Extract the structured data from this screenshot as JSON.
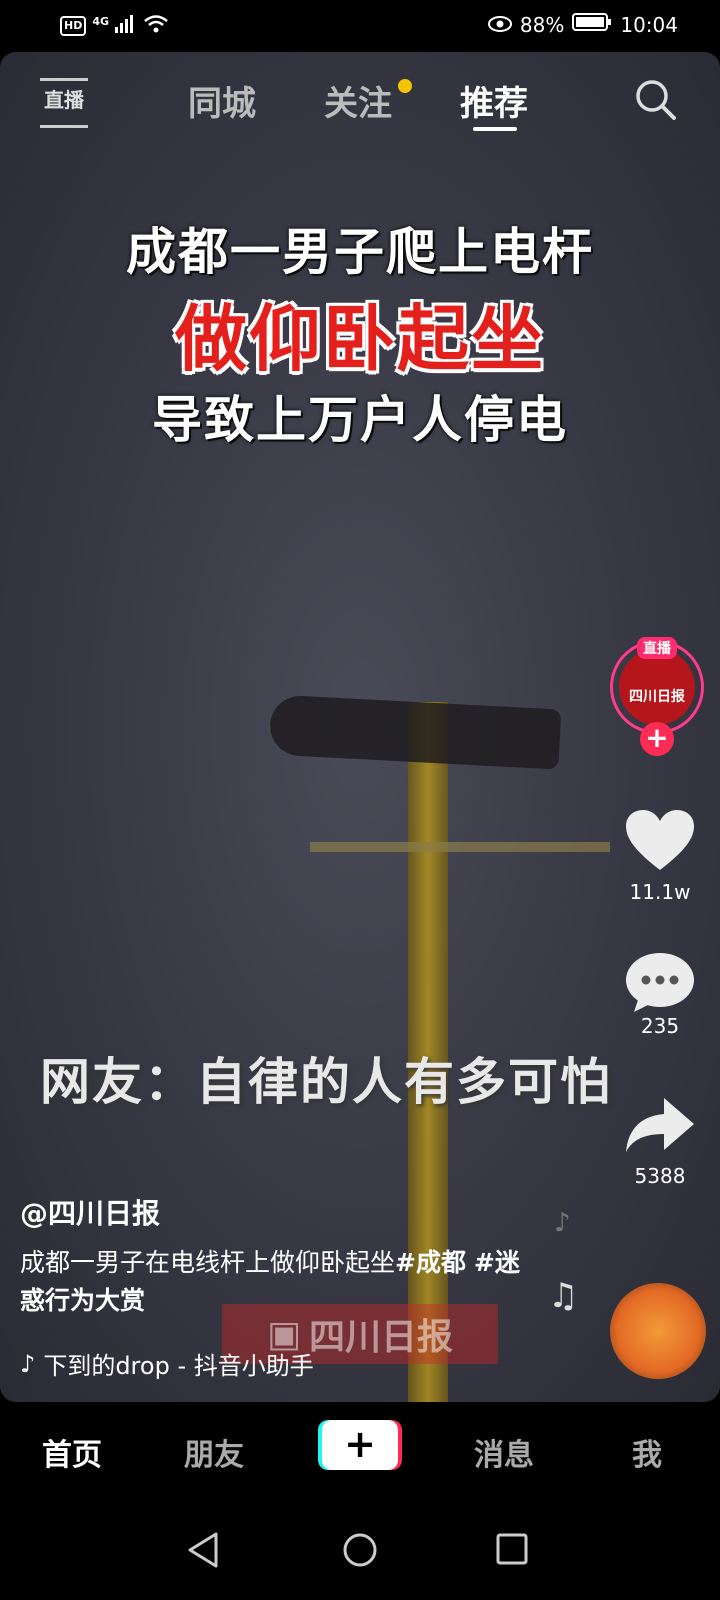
{
  "status_bar": {
    "network": "4G",
    "hd": "HD",
    "battery_percent": "88%",
    "time": "10:04"
  },
  "top_nav": {
    "live_label": "直播",
    "tabs": [
      "同城",
      "关注",
      "推荐"
    ],
    "active_tab": "推荐"
  },
  "video": {
    "caption_line1": "成都一男子爬上电杆",
    "caption_line2": "做仰卧起坐",
    "caption_line3": "导致上万户人停电",
    "caption_line4": "网友：自律的人有多可怕",
    "watermark": "四川日报"
  },
  "side_actions": {
    "avatar_live_badge": "直播",
    "avatar_text": "四川日报",
    "likes": "11.1w",
    "comments": "235",
    "shares": "5388"
  },
  "post": {
    "author": "@四川日报",
    "description_text": "成都一男子在电线杆上做仰卧起坐",
    "hashtag1": "#成都",
    "hashtag2": "#迷惑行为大赏",
    "music": "下到的drop - 抖音小助手"
  },
  "bottom_tabs": [
    "首页",
    "朋友",
    "消息",
    "我"
  ],
  "plus_label": "+",
  "colors": {
    "accent_red": "#fe2c55",
    "accent_cyan": "#25f4ee",
    "notify_dot": "#f5c400",
    "caption_red": "#e3201b"
  }
}
